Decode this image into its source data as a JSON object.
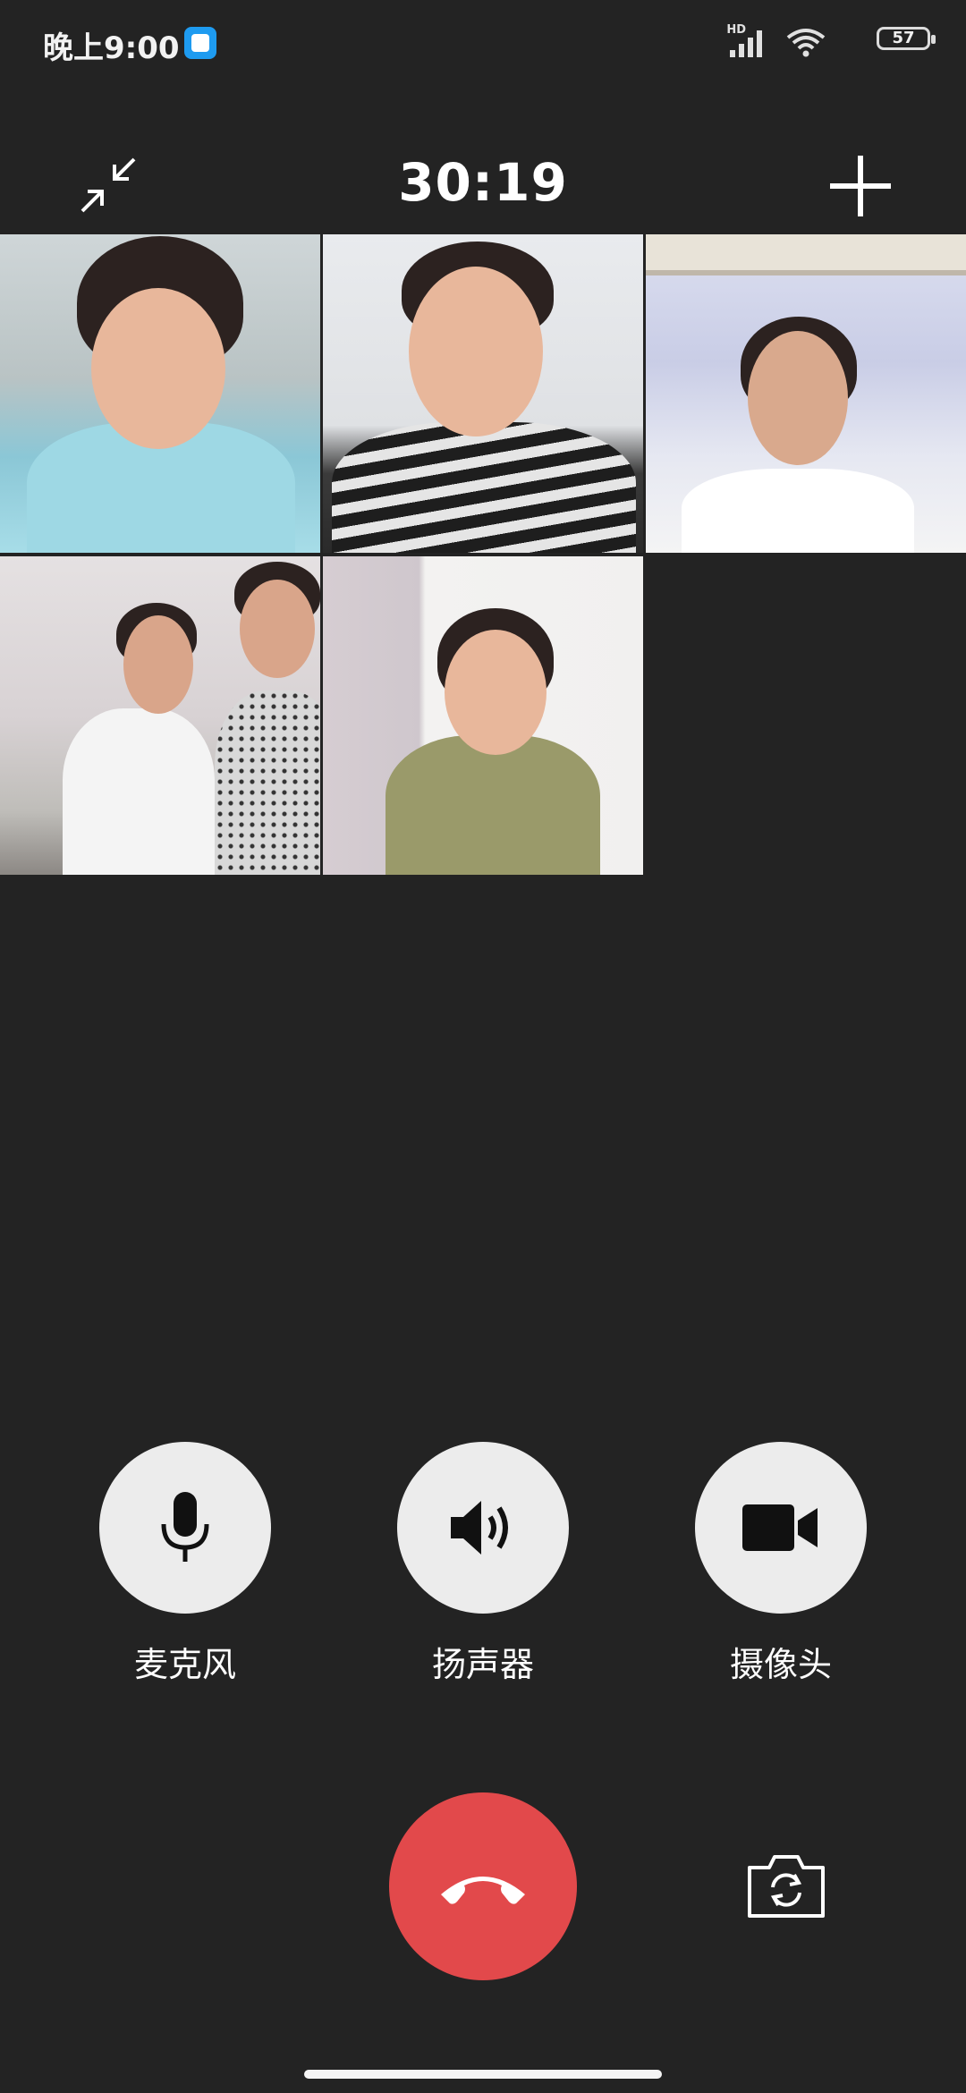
{
  "status_bar": {
    "time": "晚上9:00",
    "network": "HD",
    "battery": "57"
  },
  "call": {
    "timer": "30:19",
    "participants": [
      {
        "id": "participant-1"
      },
      {
        "id": "participant-2"
      },
      {
        "id": "participant-3"
      },
      {
        "id": "participant-4"
      },
      {
        "id": "participant-5"
      }
    ]
  },
  "controls": {
    "microphone_label": "麦克风",
    "speaker_label": "扬声器",
    "camera_label": "摄像头"
  },
  "colors": {
    "background": "#232323",
    "button_bg": "#ececec",
    "hangup": "#e2494b"
  },
  "icons": {
    "collapse": "collapse-icon",
    "add": "plus-icon",
    "microphone": "microphone-icon",
    "speaker": "speaker-icon",
    "camera": "video-camera-icon",
    "hangup": "phone-hangup-icon",
    "switch_camera": "switch-camera-icon"
  }
}
